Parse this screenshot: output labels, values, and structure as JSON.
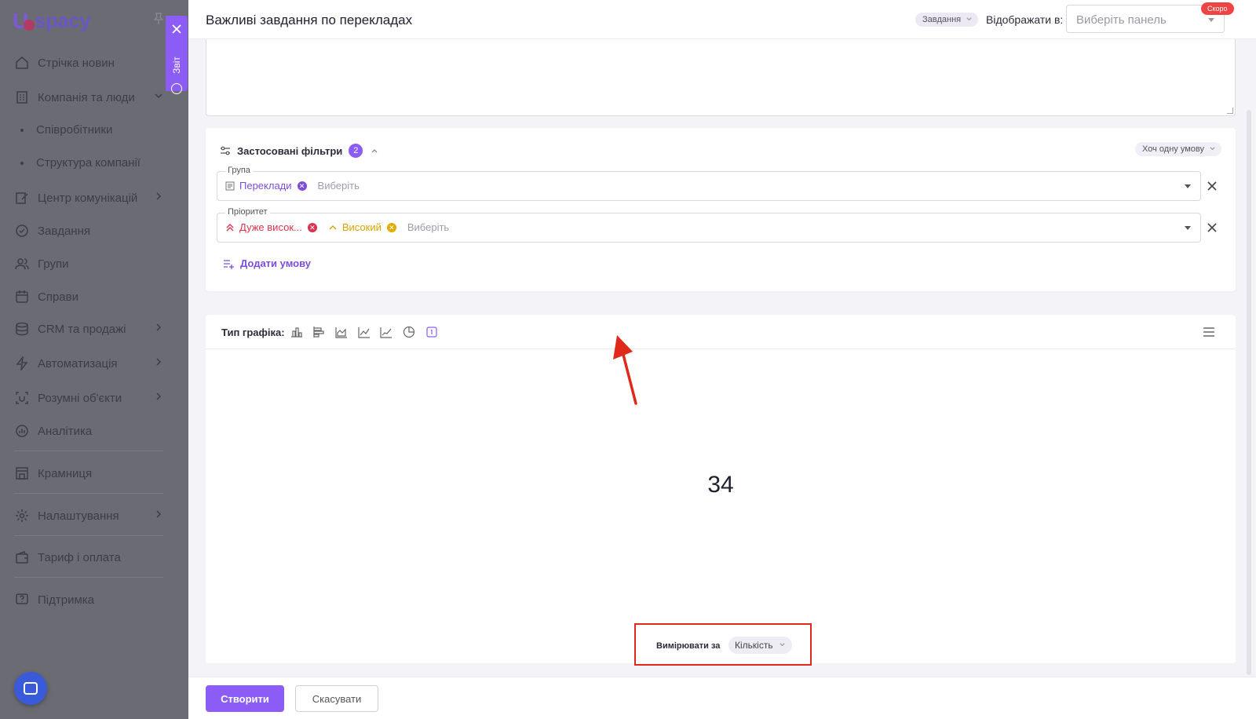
{
  "sidebar": {
    "logo_text": "spacy",
    "items": [
      {
        "label": "Стрічка новин",
        "icon": "home-icon"
      },
      {
        "label": "Компанія та люди",
        "icon": "building-icon"
      },
      {
        "label": "Співробітники"
      },
      {
        "label": "Структура компанії"
      },
      {
        "label": "Центр комунікацій",
        "icon": "edit-icon"
      },
      {
        "label": "Завдання",
        "icon": "check-circle-icon"
      },
      {
        "label": "Групи",
        "icon": "users-icon"
      },
      {
        "label": "Справи",
        "icon": "calendar-icon"
      },
      {
        "label": "CRM та продажі",
        "icon": "database-icon"
      },
      {
        "label": "Автоматизація",
        "icon": "bolt-icon"
      },
      {
        "label": "Розумні об'єкти",
        "icon": "smart-icon"
      },
      {
        "label": "Аналітика",
        "icon": "chart-icon"
      },
      {
        "label": "Крамниця",
        "icon": "store-icon"
      },
      {
        "label": "Налаштування",
        "icon": "gear-icon"
      },
      {
        "label": "Тариф і оплата",
        "icon": "wallet-icon"
      },
      {
        "label": "Підтримка",
        "icon": "help-icon"
      }
    ]
  },
  "report_tab": {
    "label": "Звіт"
  },
  "header": {
    "title": "Важливі завдання по перекладах",
    "entity_chip": "Завдання",
    "show_label": "Відображати в:",
    "panel_placeholder": "Виберіть панель",
    "soon_badge": "Скоро"
  },
  "filters": {
    "title": "Застосовані фільтри",
    "count": "2",
    "condition_mode": "Хоч одну умову",
    "group": {
      "legend": "Група",
      "tags": [
        "Переклади"
      ],
      "placeholder": "Виберіть"
    },
    "priority": {
      "legend": "Пріоритет",
      "tags": [
        "Дуже висок...",
        "Високий"
      ],
      "placeholder": "Виберіть"
    },
    "add_condition": "Додати умову"
  },
  "chart": {
    "type_label": "Тип графіка:",
    "types": [
      "bar-vertical",
      "bar-horizontal",
      "area",
      "line",
      "line-alt",
      "pie",
      "number"
    ],
    "active_type": "number",
    "value": "34",
    "measure_label": "Вимірювати за",
    "measure_value": "Кількість"
  },
  "footer": {
    "create": "Створити",
    "cancel": "Скасувати"
  },
  "colors": {
    "accent": "#8b5cf6",
    "highlight": "#e0291a"
  }
}
